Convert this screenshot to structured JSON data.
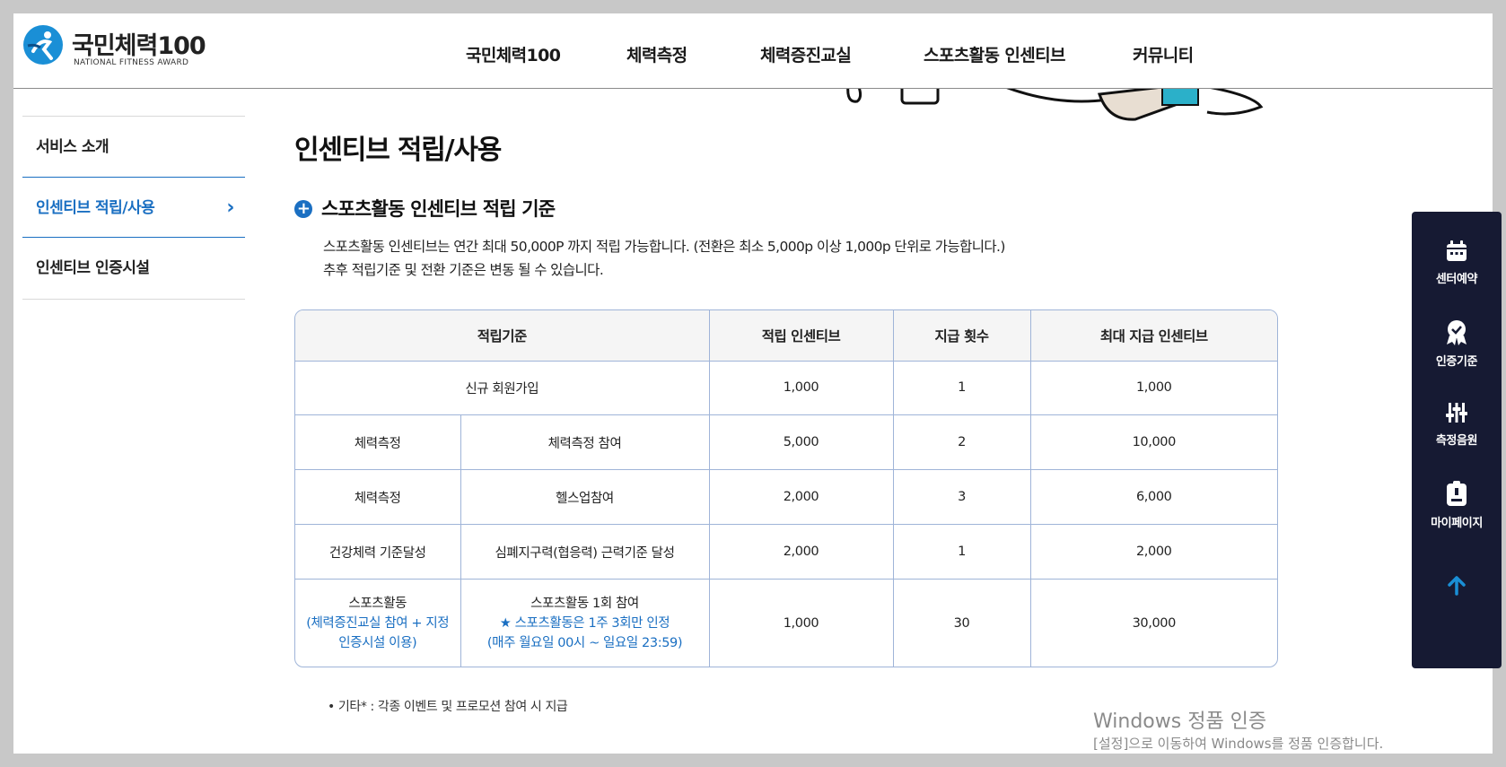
{
  "header": {
    "logo_text": "국민체력100",
    "logo_sub": "NATIONAL FITNESS AWARD",
    "nav": [
      "국민체력100",
      "체력측정",
      "체력증진교실",
      "스포츠활동 인센티브",
      "커뮤니티"
    ]
  },
  "sidebar": {
    "items": [
      {
        "label": "서비스 소개"
      },
      {
        "label": "인센티브 적립/사용"
      },
      {
        "label": "인센티브 인증시설"
      }
    ]
  },
  "main": {
    "title": "인센티브 적립/사용",
    "section_title": "스포츠활동 인센티브 적립 기준",
    "desc_line1": "스포츠활동 인센티브는 연간 최대 50,000P 까지 적립 가능합니다. (전환은 최소 5,000p 이상 1,000p 단위로 가능합니다.)",
    "desc_line2": "추후 적립기준 및 전환 기준은 변동 될 수 있습니다.",
    "table": {
      "headers": [
        "적립기준",
        "적립 인센티브",
        "지급 횟수",
        "최대 지급 인센티브"
      ],
      "rows": [
        {
          "cat": "신규 회원가입",
          "sub": "",
          "incentive": "1,000",
          "count": "1",
          "max": "1,000"
        },
        {
          "cat": "체력측정",
          "sub": "체력측정 참여",
          "incentive": "5,000",
          "count": "2",
          "max": "10,000"
        },
        {
          "cat": "체력측정",
          "sub": "헬스업참여",
          "incentive": "2,000",
          "count": "3",
          "max": "6,000"
        },
        {
          "cat": "건강체력 기준달성",
          "sub": "심폐지구력(협응력) 근력기준 달성",
          "incentive": "2,000",
          "count": "1",
          "max": "2,000"
        },
        {
          "cat": "스포츠활동",
          "cat_note1": "(체력증진교실 참여 + 지정",
          "cat_note2": "인증시설 이용)",
          "sub": "스포츠활동 1회 참여",
          "sub_note1": "★ 스포츠활동은 1주 3회만 인정",
          "sub_note2": "(매주 월요일 00시 ~ 일요일 23:59)",
          "incentive": "1,000",
          "count": "30",
          "max": "30,000"
        }
      ]
    },
    "note": "기타* : 각종 이벤트 및 프로모션 참여 시 지급"
  },
  "quick_menu": {
    "items": [
      {
        "label": "센터예약",
        "icon": "calendar-icon"
      },
      {
        "label": "인증기준",
        "icon": "badge-icon"
      },
      {
        "label": "측정음원",
        "icon": "sliders-icon"
      },
      {
        "label": "마이페이지",
        "icon": "mypage-icon"
      }
    ],
    "top_icon": "arrow-up-icon"
  },
  "watermark": {
    "line1": "Windows 정품 인증",
    "line2": "[설정]으로 이동하여 Windows를 정품 인증합니다."
  },
  "colors": {
    "accent": "#1a6fc2",
    "quick_bg": "#161a33",
    "border": "#9fb4d8"
  }
}
